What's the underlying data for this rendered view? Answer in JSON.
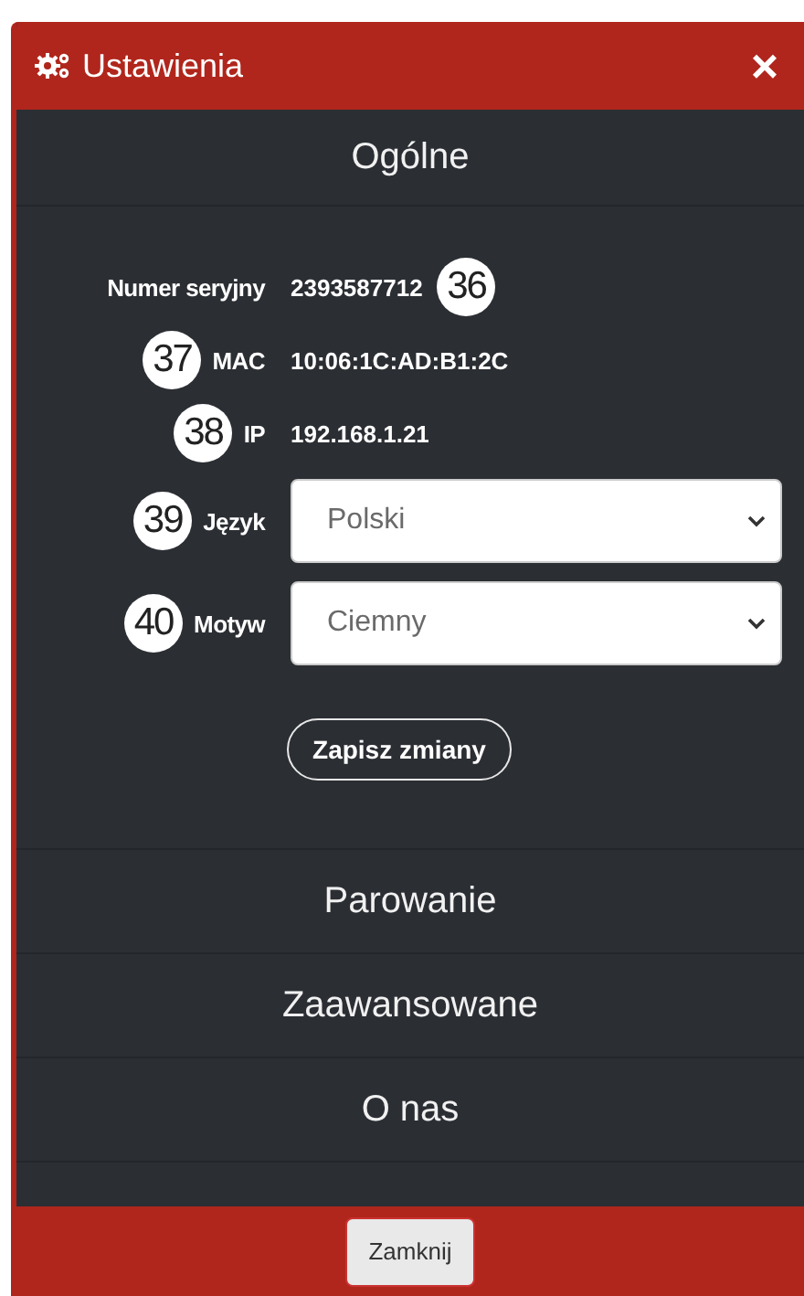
{
  "dialog": {
    "title": "Ustawienia",
    "close_symbol": "×"
  },
  "sections": [
    {
      "title": "Ogólne",
      "expanded": true
    },
    {
      "title": "Parowanie",
      "expanded": false
    },
    {
      "title": "Zaawansowane",
      "expanded": false
    },
    {
      "title": "O nas",
      "expanded": false
    }
  ],
  "general": {
    "rows": [
      {
        "kind": "text",
        "label": "Numer seryjny",
        "value": "2393587712",
        "badge_after": "36"
      },
      {
        "kind": "text",
        "label": "MAC",
        "value": "10:06:1C:AD:B1:2C",
        "badge_before": "37"
      },
      {
        "kind": "text",
        "label": "IP",
        "value": "192.168.1.21",
        "badge_before": "38"
      },
      {
        "kind": "select",
        "label": "Język",
        "value": "Polski",
        "badge_before": "39"
      },
      {
        "kind": "select",
        "label": "Motyw",
        "value": "Ciemny",
        "badge_before": "40"
      }
    ],
    "save_button": "Zapisz zmiany"
  },
  "footer": {
    "close_button": "Zamknij"
  }
}
